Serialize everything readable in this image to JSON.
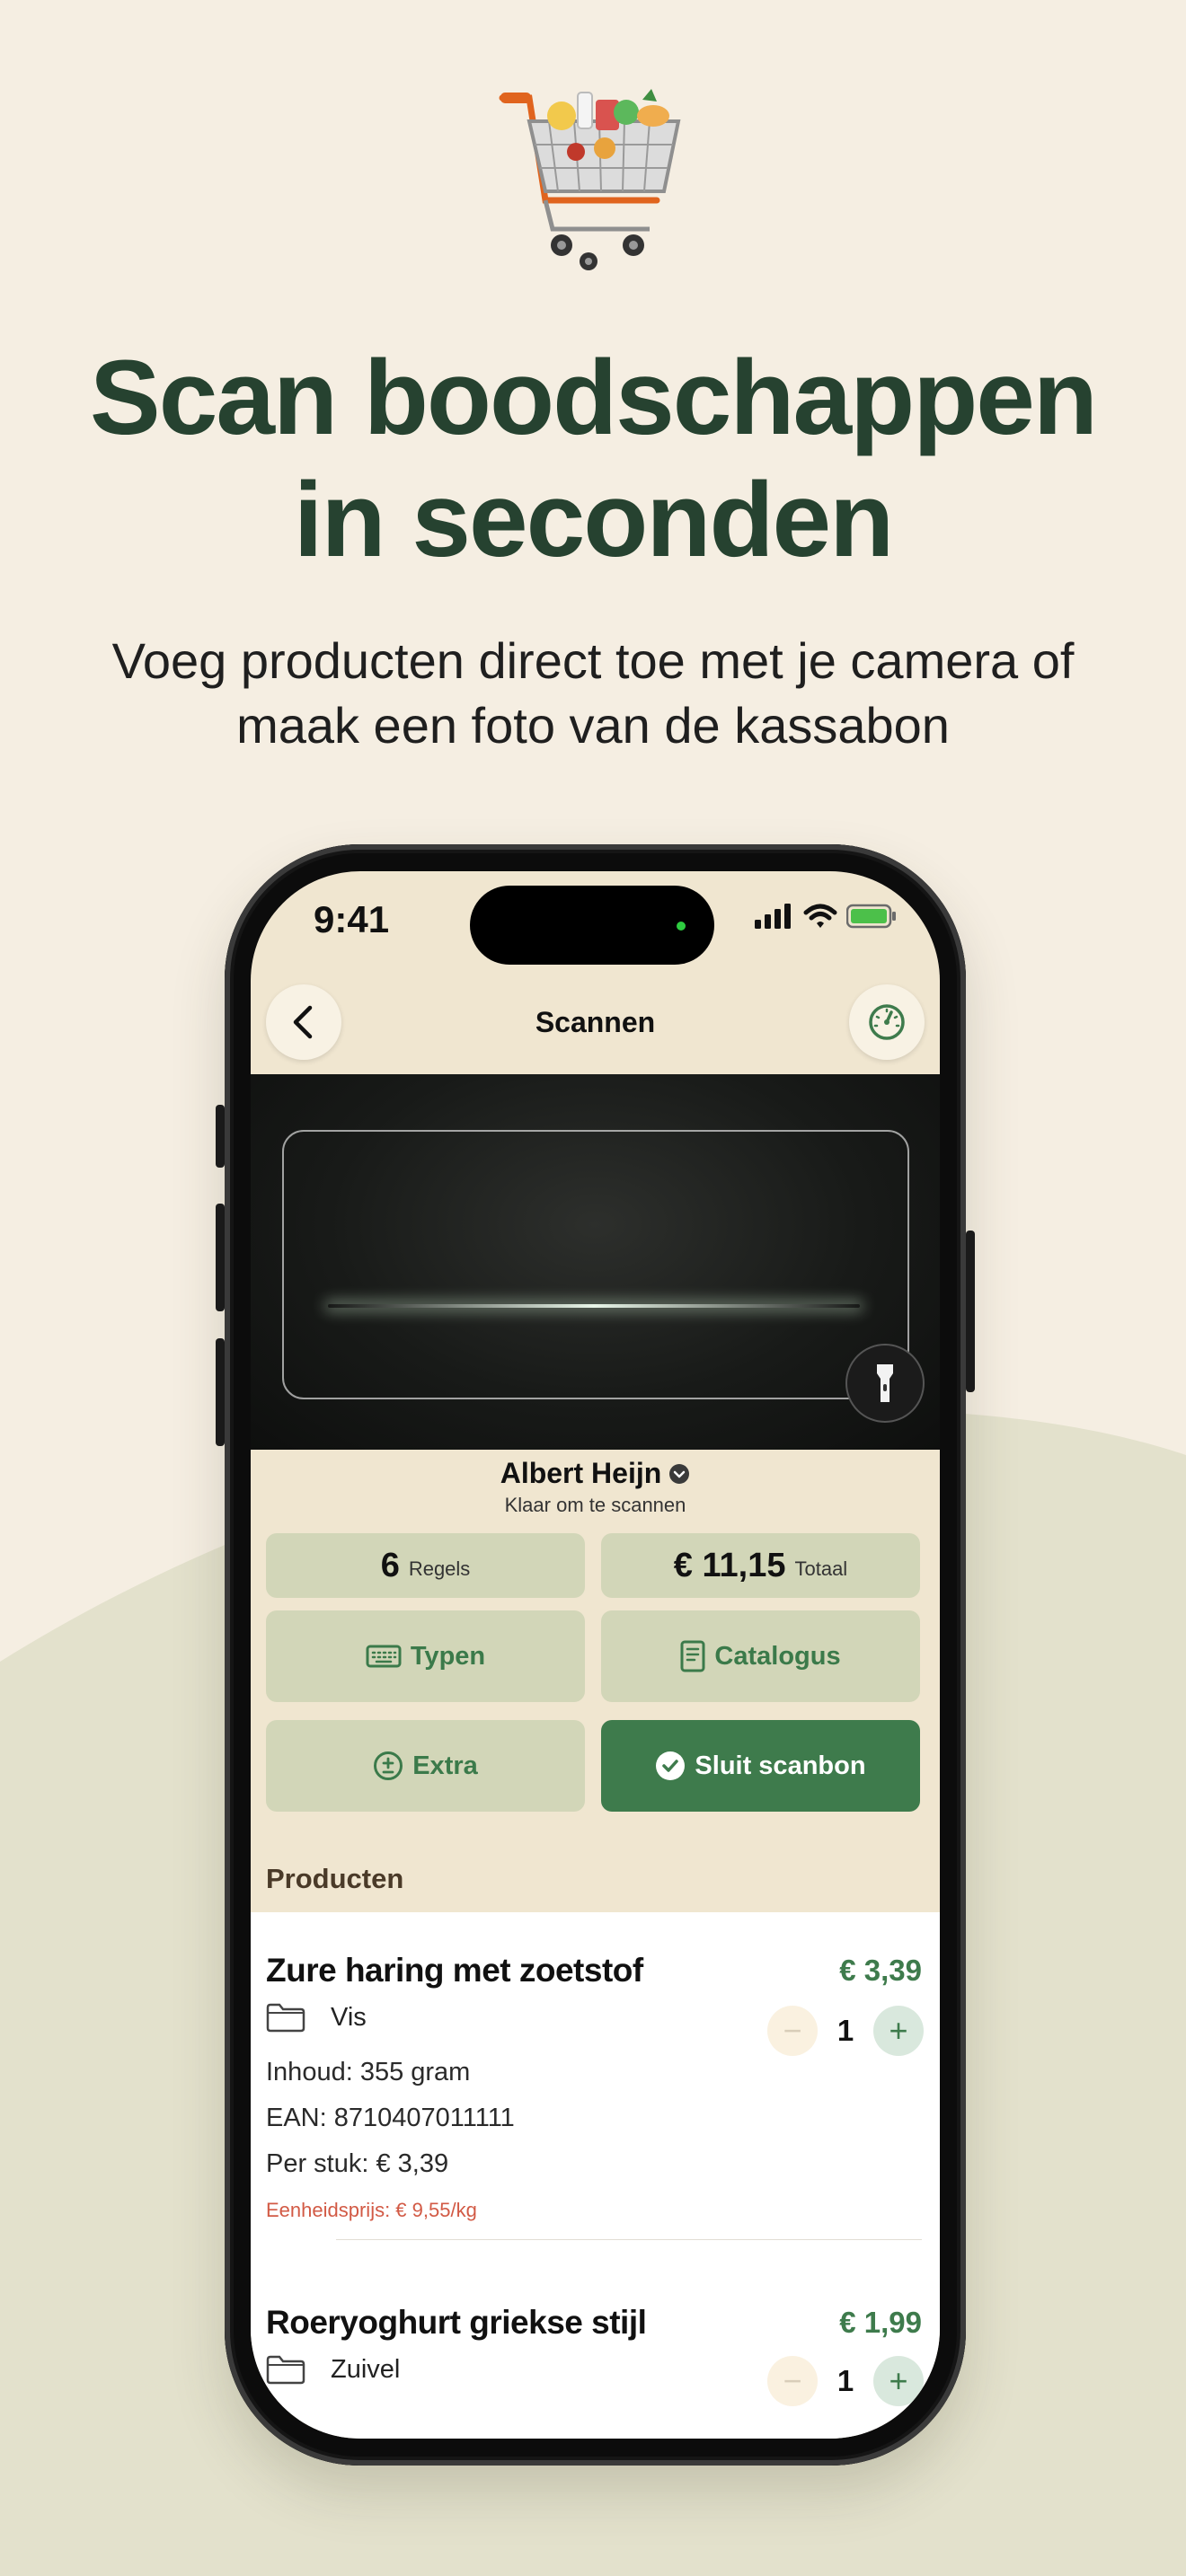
{
  "hero": {
    "cart_icon": "shopping-cart-icon",
    "headline_line1": "Scan boodschappen",
    "headline_line2": "in seconden",
    "subtitle_line1": "Voeg producten direct toe met je camera of",
    "subtitle_line2": "maak een foto van de kassabon"
  },
  "status_bar": {
    "time": "9:41",
    "icons": [
      "signal-icon",
      "wifi-icon",
      "battery-icon"
    ]
  },
  "nav": {
    "title": "Scannen",
    "back_icon": "chevron-left-icon",
    "right_icon": "gauge-icon"
  },
  "scanner": {
    "flash_icon": "flashlight-icon"
  },
  "store": {
    "name": "Albert Heijn",
    "status": "Klaar om te scannen",
    "dropdown_icon": "chevron-down-icon"
  },
  "stats": {
    "lines_count": "6",
    "lines_label": "Regels",
    "total_value": "€ 11,15",
    "total_label": "Totaal"
  },
  "actions": {
    "type_label": "Typen",
    "catalog_label": "Catalogus",
    "extra_label": "Extra",
    "close_label": "Sluit scanbon"
  },
  "products": {
    "section_title": "Producten",
    "items": [
      {
        "name": "Zure haring met zoetstof",
        "price": "€ 3,39",
        "category": "Vis",
        "content": "Inhoud: 355 gram",
        "ean": "EAN: 8710407011111",
        "per_piece": "Per stuk: € 3,39",
        "unit_price": "Eenheidsprijs: € 9,55/kg",
        "quantity": "1"
      },
      {
        "name": "Roeryoghurt griekse stijl",
        "price": "€ 1,99",
        "category": "Zuivel",
        "quantity": "1"
      }
    ]
  },
  "colors": {
    "background": "#F5EEE2",
    "wave": "#E3E1CC",
    "headline": "#264230",
    "accent_green": "#3E7B4C",
    "tile": "#D2D6B8",
    "unit_price_red": "#D25A45"
  }
}
